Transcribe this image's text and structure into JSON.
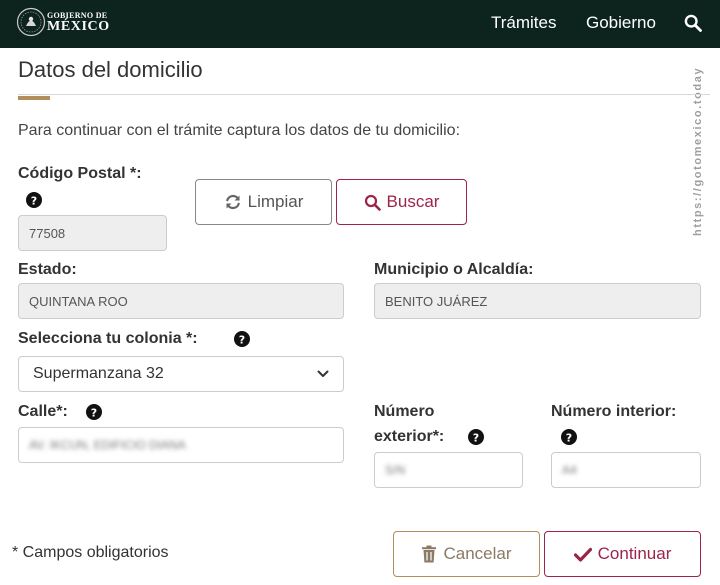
{
  "header": {
    "logo_top": "GOBIERNO DE",
    "logo_bottom": "MÉXICO",
    "nav": [
      {
        "label": "Trámites"
      },
      {
        "label": "Gobierno"
      }
    ],
    "search_icon": "search-icon",
    "background_color": "#0c231e"
  },
  "watermark": "https://gotomexico.today",
  "page": {
    "title": "Datos del domicilio",
    "intro": "Para continuar con el trámite captura los datos de tu domicilio:"
  },
  "form": {
    "postal_code": {
      "label": "Código Postal *:",
      "value": "77508"
    },
    "buttons": {
      "clear": "Limpiar",
      "search": "Buscar"
    },
    "state": {
      "label": "Estado:",
      "value": "QUINTANA ROO"
    },
    "municipality": {
      "label": "Municipio o Alcaldía:",
      "value": "BENITO JUÁREZ"
    },
    "colonia": {
      "label": "Selecciona tu colonia *:",
      "selected": "Supermanzana 32"
    },
    "street": {
      "label": "Calle*:",
      "value": "AV. IKCUN, EDIFICIO DIANA"
    },
    "ext_number": {
      "label_line1": "Número",
      "label_line2": "exterior*:",
      "value": "S/N"
    },
    "int_number": {
      "label": "Número interior:",
      "value": "A4"
    }
  },
  "footer": {
    "required_note": "* Campos obligatorios",
    "cancel": "Cancelar",
    "continue": "Continuar"
  },
  "colors": {
    "accent_gold": "#b38e5d",
    "accent_wine": "#9d2449",
    "readonly_bg": "#eeeeee"
  }
}
